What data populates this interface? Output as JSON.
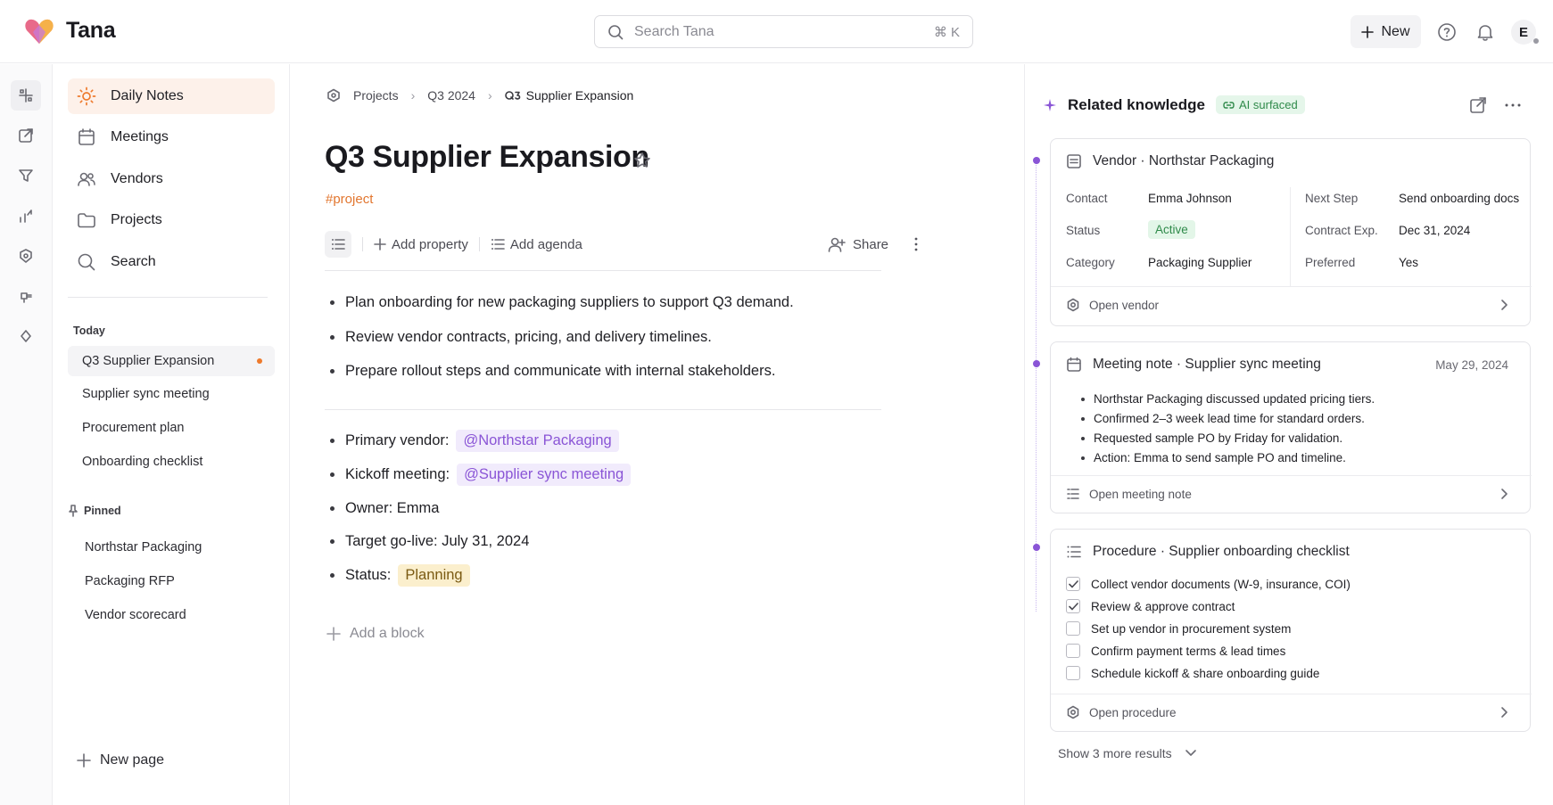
{
  "app": {
    "name": "Tana"
  },
  "search": {
    "placeholder": "Search Tana",
    "shortcut": "⌘ K"
  },
  "header": {
    "new_label": "New",
    "avatar_initial": "E"
  },
  "rail": {
    "icons": [
      "grid-icon",
      "export-icon",
      "filter-icon",
      "chart-icon",
      "shield-icon",
      "plug-icon",
      "diamond-icon"
    ]
  },
  "sidebar": {
    "nav": [
      {
        "label": "Daily Notes",
        "icon": "sun-icon"
      },
      {
        "label": "Meetings",
        "icon": "calendar-icon"
      },
      {
        "label": "Vendors",
        "icon": "users-icon"
      },
      {
        "label": "Projects",
        "icon": "folder-icon"
      },
      {
        "label": "Search",
        "icon": "search-icon"
      }
    ],
    "today_label": "Today",
    "today": [
      "Q3 Supplier Expansion",
      "Supplier sync meeting",
      "Procurement plan",
      "Onboarding checklist"
    ],
    "pinned_label": "Pinned",
    "pinned": [
      "Northstar Packaging",
      "Packaging RFP",
      "Vendor scorecard"
    ],
    "new_page": "New page"
  },
  "main": {
    "breadcrumb": [
      "Projects",
      "Q3 2024",
      "Supplier Expansion"
    ],
    "title": "Q3 Supplier Expansion",
    "tag": "#project",
    "toolbar": {
      "add_property": "Add property",
      "add_agenda": "Add agenda",
      "share": "Share"
    },
    "bullets": [
      "Plan onboarding for new packaging suppliers to support Q3 demand.",
      "Review vendor contracts, pricing, and delivery timelines.",
      "Prepare rollout steps and communicate with internal stakeholders."
    ],
    "fields": {
      "primary_vendor_label": "Primary vendor:",
      "primary_vendor_value": "@Northstar Packaging",
      "kickoff_label": "Kickoff meeting:",
      "kickoff_value": "@Supplier sync meeting",
      "owner": "Owner: Emma",
      "target": "Target go-live: July 31, 2024",
      "status_label": "Status:",
      "status_value": "Planning"
    },
    "add_block": "Add a block"
  },
  "related": {
    "title": "Related knowledge",
    "badge": "AI surfaced",
    "vendor_card": {
      "title": "Vendor · Northstar Packaging",
      "contact_k": "Contact",
      "contact_v": "Emma Johnson",
      "status_k": "Status",
      "status_v": "Active",
      "category_k": "Category",
      "category_v": "Packaging Supplier",
      "next_k": "Next Step",
      "next_v": "Send onboarding docs",
      "contract_k": "Contract Exp.",
      "contract_v": "Dec 31, 2024",
      "preferred_k": "Preferred",
      "preferred_v": "Yes",
      "footer": "Open vendor"
    },
    "meeting_card": {
      "title": "Meeting note · Supplier sync meeting",
      "date": "May 29, 2024",
      "bullets": [
        "Northstar Packaging discussed updated pricing tiers.",
        "Confirmed 2–3 week lead time for standard orders.",
        "Requested sample PO by Friday for validation.",
        "Action: Emma to send sample PO and timeline."
      ],
      "footer": "Open meeting note"
    },
    "procedure_card": {
      "title": "Procedure · Supplier onboarding checklist",
      "items": [
        {
          "label": "Collect vendor documents (W-9, insurance, COI)",
          "checked": true
        },
        {
          "label": "Review & approve contract",
          "checked": true
        },
        {
          "label": "Set up vendor in procurement system",
          "checked": false
        },
        {
          "label": "Confirm payment terms & lead times",
          "checked": false
        },
        {
          "label": "Schedule kickoff & share onboarding guide",
          "checked": false
        }
      ],
      "footer": "Open procedure"
    },
    "show_more": "Show 3 more results"
  },
  "colors": {
    "accent": "#ee7a2c",
    "mention": "#8a55d6",
    "ai_green": "#2f8a4a"
  }
}
